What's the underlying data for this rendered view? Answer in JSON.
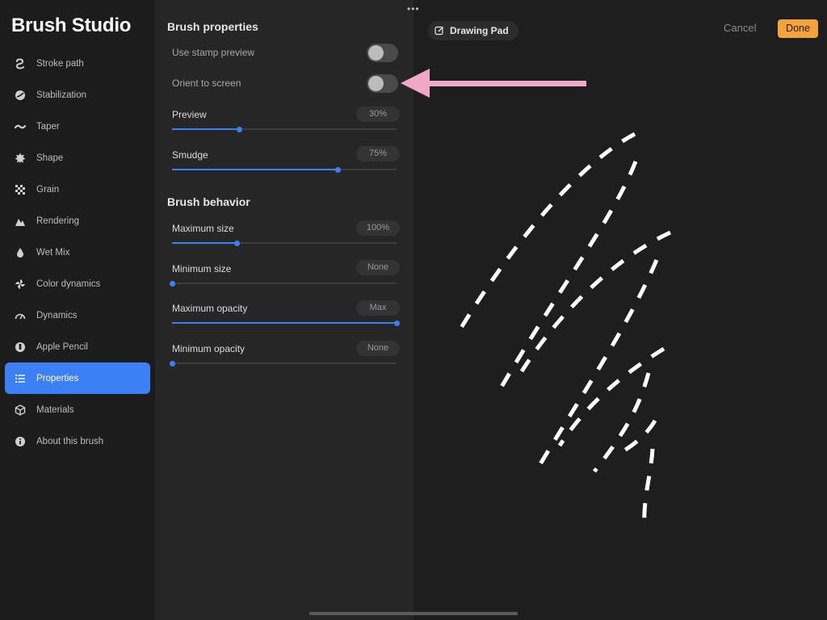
{
  "app": {
    "title": "Brush Studio"
  },
  "sidebar": {
    "items": [
      {
        "label": "Stroke path",
        "icon": "stroke-path-icon"
      },
      {
        "label": "Stabilization",
        "icon": "stabilization-icon"
      },
      {
        "label": "Taper",
        "icon": "taper-icon"
      },
      {
        "label": "Shape",
        "icon": "shape-icon"
      },
      {
        "label": "Grain",
        "icon": "grain-icon"
      },
      {
        "label": "Rendering",
        "icon": "rendering-icon"
      },
      {
        "label": "Wet Mix",
        "icon": "wet-mix-icon"
      },
      {
        "label": "Color dynamics",
        "icon": "color-dynamics-icon"
      },
      {
        "label": "Dynamics",
        "icon": "dynamics-icon"
      },
      {
        "label": "Apple Pencil",
        "icon": "apple-pencil-icon"
      },
      {
        "label": "Properties",
        "icon": "properties-icon",
        "active": true
      },
      {
        "label": "Materials",
        "icon": "materials-icon"
      },
      {
        "label": "About this brush",
        "icon": "info-icon"
      }
    ]
  },
  "panel": {
    "brush_properties": {
      "title": "Brush properties",
      "use_stamp_preview": {
        "label": "Use stamp preview",
        "on": false
      },
      "orient_to_screen": {
        "label": "Orient to screen",
        "on": false
      },
      "preview": {
        "label": "Preview",
        "value": "30%",
        "level": 0.3
      },
      "smudge": {
        "label": "Smudge",
        "value": "75%",
        "level": 0.74
      }
    },
    "brush_behavior": {
      "title": "Brush behavior",
      "maximum_size": {
        "label": "Maximum size",
        "value": "100%",
        "level": 0.29
      },
      "minimum_size": {
        "label": "Minimum size",
        "value": "None",
        "level": 0.0
      },
      "maximum_opacity": {
        "label": "Maximum opacity",
        "value": "Max",
        "level": 1.0
      },
      "minimum_opacity": {
        "label": "Minimum opacity",
        "value": "None",
        "level": 0.0
      }
    }
  },
  "toolbar": {
    "drawing_pad": "Drawing Pad",
    "cancel": "Cancel",
    "done": "Done",
    "more": "•••"
  },
  "colors": {
    "accent": "#3d7ff4",
    "done": "#f2a33c",
    "annotation_arrow": "#f0a8c8",
    "stroke": "#ffffff"
  }
}
